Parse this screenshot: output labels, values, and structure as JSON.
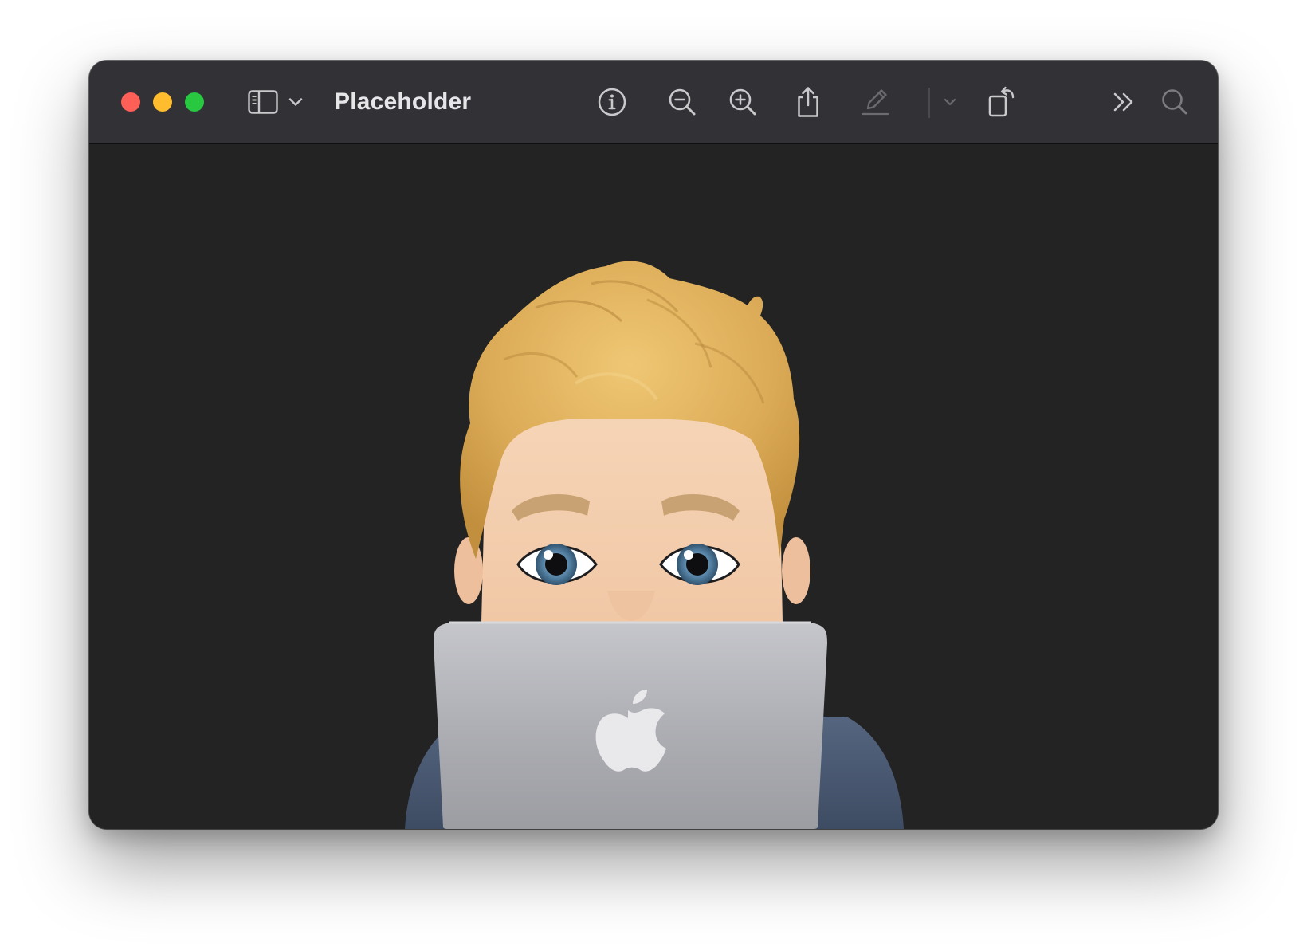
{
  "window": {
    "title": "Placeholder"
  },
  "traffic_lights": {
    "close": "#fe5f57",
    "minimize": "#febc2e",
    "maximize": "#28c840"
  },
  "toolbar": {
    "icons": [
      "sidebar-icon",
      "chevron-down-icon",
      "info-icon",
      "zoom-out-icon",
      "zoom-in-icon",
      "share-icon",
      "markup-pen-icon",
      "markup-chevron-down-icon",
      "rotate-icon",
      "overflow-chevron-icon",
      "search-icon"
    ],
    "icon_color": "#c9c9cc",
    "disabled_icon_color": "#6b6b70"
  },
  "document": {
    "image": "memoji-behind-laptop"
  },
  "colors": {
    "toolbar_background": "#323236",
    "content_background": "#232323",
    "title_text": "#e6e6e8"
  }
}
